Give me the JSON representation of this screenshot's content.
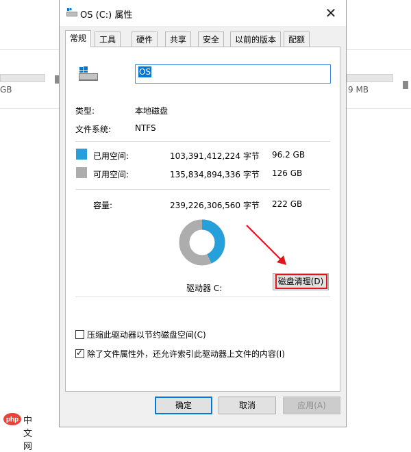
{
  "background": {
    "left_size_fragment": "GB",
    "right_size_fragment": "9 MB"
  },
  "dialog": {
    "title": "OS (C:) 属性",
    "close_glyph": "✕",
    "tabs": [
      {
        "label": "常规",
        "active": true
      },
      {
        "label": "工具"
      },
      {
        "label": "硬件"
      },
      {
        "label": "共享"
      },
      {
        "label": "安全"
      },
      {
        "label": "以前的版本"
      },
      {
        "label": "配额"
      }
    ],
    "volume_name": "OS",
    "type": {
      "label": "类型:",
      "value": "本地磁盘"
    },
    "filesystem": {
      "label": "文件系统:",
      "value": "NTFS"
    },
    "used": {
      "label": "已用空间:",
      "bytes": "103,391,412,224 字节",
      "size": "96.2 GB",
      "color": "#26a0da"
    },
    "free": {
      "label": "可用空间:",
      "bytes": "135,834,894,336 字节",
      "size": "126 GB",
      "color": "#adadad"
    },
    "capacity": {
      "label": "容量:",
      "bytes": "239,226,306,560 字节",
      "size": "222 GB"
    },
    "usage": {
      "used_fraction": 0.432
    },
    "drive_label": "驱动器 C:",
    "cleanup_button": "磁盘清理(D)",
    "compress_option": {
      "label": "压缩此驱动器以节约磁盘空间(C)",
      "checked": false
    },
    "index_option": {
      "label": "除了文件属性外，还允许索引此驱动器上文件的内容(I)",
      "checked": true
    },
    "buttons": {
      "ok": "确定",
      "cancel": "取消",
      "apply": "应用(A)"
    }
  },
  "watermark": {
    "logo_text": "php",
    "text": "中文网"
  },
  "colors": {
    "accent": "#0078d7",
    "highlight": "#e0141b"
  }
}
